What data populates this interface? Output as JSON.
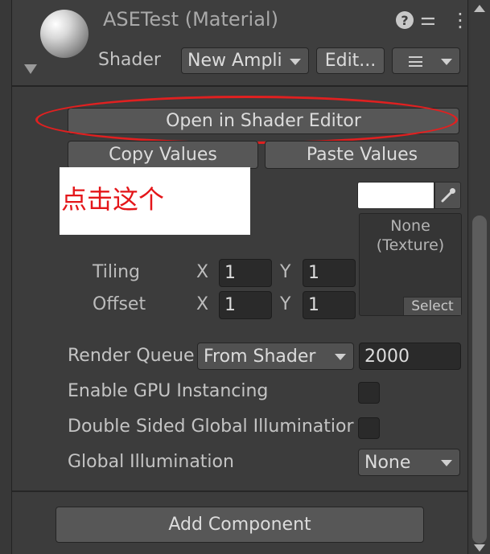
{
  "header": {
    "title": "ASETest (Material)",
    "shader_label": "Shader",
    "shader_value": "New Ampli",
    "edit_label": "Edit...",
    "help_icon": "?",
    "settings_icon": "⚌",
    "more_icon": "⋮"
  },
  "buttons": {
    "open_shader_editor": "Open in Shader Editor",
    "copy_values": "Copy Values",
    "paste_values": "Paste Values",
    "add_component": "Add Component"
  },
  "annotation": {
    "text": "点击这个",
    "color": "#e4161a"
  },
  "texture": {
    "none_line1": "None",
    "none_line2": "(Texture)",
    "select_label": "Select"
  },
  "tiling": {
    "label": "Tiling",
    "x_label": "X",
    "x_value": "1",
    "y_label": "Y",
    "y_value": "1"
  },
  "offset": {
    "label": "Offset",
    "x_label": "X",
    "x_value": "1",
    "y_label": "Y",
    "y_value": "1"
  },
  "render_queue": {
    "label": "Render Queue",
    "mode": "From Shader",
    "value": "2000"
  },
  "gpu_instancing": {
    "label": "Enable GPU Instancing"
  },
  "double_sided_gi": {
    "label": "Double Sided Global Illuminatior"
  },
  "global_illumination": {
    "label": "Global Illumination",
    "value": "None"
  }
}
